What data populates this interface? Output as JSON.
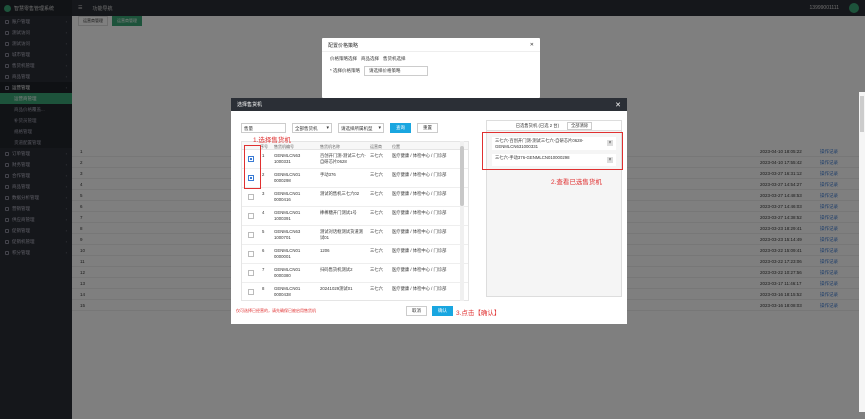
{
  "app": {
    "title": "智慧零售管理系统",
    "menu_label": "功能导航",
    "user": "13999001111"
  },
  "sidebar": {
    "items": [
      {
        "label": "账户管理"
      },
      {
        "label": "测试访问"
      },
      {
        "label": "测试访问"
      },
      {
        "label": "城市管理"
      },
      {
        "label": "售货机管理"
      },
      {
        "label": "商品管理"
      },
      {
        "label": "运营管理"
      }
    ],
    "subs": [
      {
        "label": "运营商管理"
      },
      {
        "label": "商品价格覆盖..."
      },
      {
        "label": "补货员管理"
      },
      {
        "label": "规格管理"
      },
      {
        "label": "货道配置管理"
      }
    ],
    "items2": [
      {
        "label": "订单管理"
      },
      {
        "label": "财务管理"
      },
      {
        "label": "合作管理"
      },
      {
        "label": "商品管理"
      },
      {
        "label": "数据分析管理"
      },
      {
        "label": "营销管理"
      },
      {
        "label": "供应商管理"
      },
      {
        "label": "促销管理"
      },
      {
        "label": "促销机管理"
      },
      {
        "label": "积分管理"
      }
    ]
  },
  "tabs": [
    {
      "label": "运营商管理"
    },
    {
      "label": "运营商管理"
    }
  ],
  "bg_rows": [
    {
      "id": "1",
      "date": "2023-04-10 18:05:22",
      "op": "操作记录"
    },
    {
      "id": "2",
      "date": "2023-04-10 17:55:42",
      "op": "操作记录"
    },
    {
      "id": "3",
      "date": "2023-03-27 16:31:12",
      "op": "操作记录"
    },
    {
      "id": "4",
      "date": "2023-03-27 14:54:27",
      "op": "操作记录"
    },
    {
      "id": "5",
      "date": "2023-03-27 14:48:53",
      "op": "操作记录"
    },
    {
      "id": "6",
      "date": "2023-03-27 14:46:03",
      "op": "操作记录"
    },
    {
      "id": "7",
      "date": "2023-03-27 14:38:52",
      "op": "操作记录"
    },
    {
      "id": "8",
      "date": "2023-03-23 18:29:41",
      "op": "操作记录"
    },
    {
      "id": "9",
      "date": "2023-03-23 15:14:49",
      "op": "操作记录"
    },
    {
      "id": "10",
      "date": "2023-03-22 15:09:41",
      "op": "操作记录"
    },
    {
      "id": "11",
      "date": "2023-03-22 17:23:06",
      "op": "操作记录"
    },
    {
      "id": "12",
      "date": "2023-03-22 10:27:56",
      "op": "操作记录"
    },
    {
      "id": "13",
      "date": "2023-03-17 11:46:17",
      "op": "操作记录"
    },
    {
      "id": "14",
      "date": "2023-03-16 18:15:52",
      "op": "操作记录"
    },
    {
      "id": "15",
      "date": "2023-03-16 18:08:03",
      "op": "操作记录"
    }
  ],
  "back_modal": {
    "title": "配置价格策略",
    "radio1": "价格策略选择",
    "radio2": "商品选择",
    "radio3": "售货机选择",
    "label": "* 选择价格策略",
    "select": "请选择价格策略"
  },
  "dialog": {
    "title": "选择售货机",
    "search_value": "售量",
    "region": "全部售货机",
    "type": "请选择所属机型",
    "search_btn": "查询",
    "reset_btn": "重置",
    "headers": [
      "序号",
      "售货机编号",
      "售货机名称",
      "运营商",
      "位置"
    ],
    "rows": [
      {
        "no": "1",
        "code": "GENMLCN63 1000331",
        "name": "百创开门测-测试三七六-自研芯片0628",
        "op": "三七六",
        "loc": "医疗健康 / 体检中心 / 门诊部",
        "checked": true
      },
      {
        "no": "2",
        "code": "GENMLCN01 0000298",
        "name": "手动376",
        "op": "三七六",
        "loc": "医疗健康 / 体检中心 / 门诊部",
        "checked": true
      },
      {
        "no": "3",
        "code": "GENMLCN01 0000416",
        "name": "测试的售机三七六02",
        "op": "三七六",
        "loc": "医疗健康 / 体检中心 / 门诊部",
        "checked": false
      },
      {
        "no": "4",
        "code": "GENMLCN01 1000391",
        "name": "棒棒糖开门测试1号",
        "op": "三七六",
        "loc": "医疗健康 / 体检中心 / 门诊部",
        "checked": false
      },
      {
        "no": "5",
        "code": "GENMLCN63 1000701",
        "name": "测试对话框测试货道测试01",
        "op": "三七六",
        "loc": "医疗健康 / 体检中心 / 门诊部",
        "checked": false
      },
      {
        "no": "6",
        "code": "GENMLCN01 0000001",
        "name": "1206",
        "op": "三七六",
        "loc": "医疗健康 / 体检中心 / 门诊部",
        "checked": false
      },
      {
        "no": "7",
        "code": "GENMLCN01 0000380",
        "name": "扫码售货机测试2",
        "op": "三七六",
        "loc": "医疗健康 / 体检中心 / 门诊部",
        "checked": false
      },
      {
        "no": "8",
        "code": "GENMLCN01 0000438",
        "name": "20241029测试01",
        "op": "三七六",
        "loc": "医疗健康 / 体检中心 / 门诊部",
        "checked": false
      }
    ],
    "right_title": "已选售货机 (已选 2 台)",
    "clear_btn": "全部清除",
    "picked": [
      "三七六-百创开门测-测试三七六-自研芯片0628-GENMLCN631000331",
      "三七六-手动376-GENMLCN010000298"
    ],
    "note": "仅可选择已经营的，请先确保已被启用售货机",
    "cancel_btn": "取消",
    "ok_btn": "确认"
  },
  "annotations": {
    "step1": "1.选择售货机",
    "step2": "2.查看已选售货机",
    "step3": "3.点击【确认】"
  },
  "colors": {
    "accent": "#3aa676",
    "primary": "#19a6e0",
    "annotation": "#e03030"
  }
}
